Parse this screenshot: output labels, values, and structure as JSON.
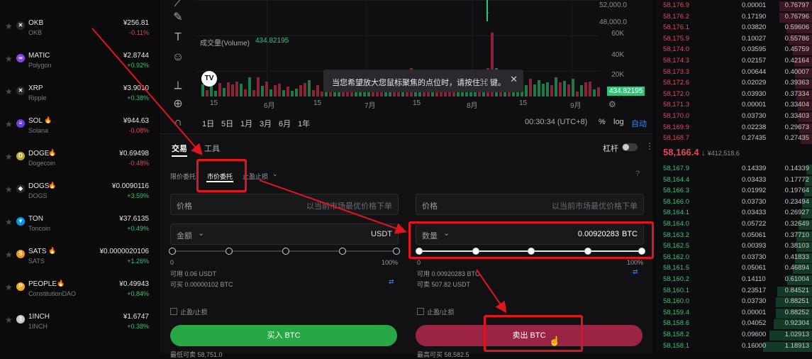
{
  "coins": [
    {
      "sym": "OKB",
      "name": "OKB",
      "price": "¥256.81",
      "chg": "-0.11%",
      "dir": "neg",
      "color": "#2b2b2b",
      "glyph": "✕",
      "fire": false
    },
    {
      "sym": "MATIC",
      "name": "Polygon",
      "price": "¥2.8744",
      "chg": "+0.92%",
      "dir": "pos",
      "color": "#8247e5",
      "glyph": "∞",
      "fire": false
    },
    {
      "sym": "XRP",
      "name": "Ripple",
      "price": "¥3.9010",
      "chg": "+0.38%",
      "dir": "pos",
      "color": "#2b2b2b",
      "glyph": "✕",
      "fire": false
    },
    {
      "sym": "SOL",
      "name": "Solana",
      "price": "¥944.63",
      "chg": "-0.08%",
      "dir": "neg",
      "color": "#6a3de0",
      "glyph": "≡",
      "fire": true
    },
    {
      "sym": "DOGE",
      "name": "Dogecoin",
      "price": "¥0.69498",
      "chg": "-0.48%",
      "dir": "neg",
      "color": "#c2a633",
      "glyph": "D",
      "fire": true
    },
    {
      "sym": "DOGS",
      "name": "DOGS",
      "price": "¥0.0090116",
      "chg": "+3.59%",
      "dir": "pos",
      "color": "#2b2b2b",
      "glyph": "◆",
      "fire": true
    },
    {
      "sym": "TON",
      "name": "Toncoin",
      "price": "¥37.6135",
      "chg": "+0.49%",
      "dir": "pos",
      "color": "#0098ea",
      "glyph": "▼",
      "fire": false
    },
    {
      "sym": "SATS",
      "name": "SATS",
      "price": "¥0.0000020106",
      "chg": "+1.26%",
      "dir": "pos",
      "color": "#f7931a",
      "glyph": "S",
      "fire": true
    },
    {
      "sym": "PEOPLE",
      "name": "ConstitutionDAO",
      "price": "¥0.49943",
      "chg": "+0.84%",
      "dir": "pos",
      "color": "#f5a623",
      "glyph": "P",
      "fire": true
    },
    {
      "sym": "1INCH",
      "name": "1INCH",
      "price": "¥1.6747",
      "chg": "+0.38%",
      "dir": "pos",
      "color": "#c9c9cc",
      "glyph": "1",
      "fire": false
    }
  ],
  "chart": {
    "volume_label": "成交量(Volume)",
    "volume_value": "434.82195",
    "yaxis": [
      "52,000.0",
      "48,000.0",
      "60K",
      "40K",
      "20K"
    ],
    "last_volume": "434.82195",
    "xlabels": [
      "15",
      "6月",
      "15",
      "7月",
      "15",
      "8月",
      "15",
      "9月"
    ],
    "timeframes": [
      "1日",
      "5日",
      "1月",
      "3月",
      "6月",
      "1年"
    ],
    "time": "00:30:34 (UTC+8)",
    "pct": "%",
    "log": "log",
    "auto": "自动",
    "tooltip": "当您希望放大您鼠标聚焦的点位时，请按住⌘ 键。"
  },
  "trade": {
    "tabs": [
      "交易",
      "工具"
    ],
    "leverage": "杠杆",
    "order_types": [
      "限价委托",
      "市价委托",
      "止盈止损"
    ],
    "buy": {
      "price_label": "价格",
      "price_ph": "以当前市场最优价格下单",
      "amount_label": "金额",
      "amount_unit": "USDT",
      "pct0": "0",
      "pct100": "100%",
      "avail": "可用 0.06 USDT",
      "can": "可买 0.00000102 BTC",
      "tp": "止盈/止损",
      "btn": "买入 BTC",
      "bottom": "最低可卖 58,751.0"
    },
    "sell": {
      "price_label": "价格",
      "price_ph": "以当前市场最优价格下单",
      "qty_label": "数量",
      "qty_value": "0.00920283",
      "qty_unit": "BTC",
      "pct0": "0",
      "pct100": "100%",
      "avail": "可用 0.00920283 BTC",
      "can": "可卖 507.82 USDT",
      "tp": "止盈/止损",
      "btn": "卖出 BTC",
      "bottom": "最高可买 58,582.5"
    }
  },
  "orderbook": {
    "asks": [
      [
        "58,176.9",
        "0.00001",
        "0.76797"
      ],
      [
        "58,176.2",
        "0.17190",
        "0.76796"
      ],
      [
        "58,176.1",
        "0.03820",
        "0.59606"
      ],
      [
        "58,175.9",
        "0.10027",
        "0.55786"
      ],
      [
        "58,174.0",
        "0.03595",
        "0.45759"
      ],
      [
        "58,174.3",
        "0.02157",
        "0.42164"
      ],
      [
        "58,173.3",
        "0.00644",
        "0.40007"
      ],
      [
        "58,172.6",
        "0.02029",
        "0.39363"
      ],
      [
        "58,172.0",
        "0.03930",
        "0.37334"
      ],
      [
        "58,171.3",
        "0.00001",
        "0.33404"
      ],
      [
        "58,170.0",
        "0.03730",
        "0.33403"
      ],
      [
        "58,169.9",
        "0.02238",
        "0.29673"
      ],
      [
        "58,168.7",
        "0.27435",
        "0.27435"
      ]
    ],
    "last_price": "58,166.4",
    "last_arrow": "↓",
    "last_cny": "¥412,518.6",
    "bids": [
      [
        "58,167.9",
        "0.14339",
        "0.14339"
      ],
      [
        "58,164.4",
        "0.03433",
        "0.17772"
      ],
      [
        "58,166.3",
        "0.01992",
        "0.19764"
      ],
      [
        "58,166.0",
        "0.03730",
        "0.23494"
      ],
      [
        "58,164.1",
        "0.03433",
        "0.26927"
      ],
      [
        "58,164.0",
        "0.05722",
        "0.32649"
      ],
      [
        "58,163.2",
        "0.05061",
        "0.37710"
      ],
      [
        "58,162.5",
        "0.00393",
        "0.38103"
      ],
      [
        "58,162.0",
        "0.03730",
        "0.41833"
      ],
      [
        "58,161.5",
        "0.05061",
        "0.46894"
      ],
      [
        "58,160.2",
        "0.14110",
        "0.61004"
      ],
      [
        "58,160.1",
        "0.23517",
        "0.84521"
      ],
      [
        "58,160.0",
        "0.03730",
        "0.88251"
      ],
      [
        "58,159.4",
        "0.00001",
        "0.88252"
      ],
      [
        "58,158.6",
        "0.04052",
        "0.92304"
      ],
      [
        "58,158.2",
        "0.09600",
        "1.02913"
      ],
      [
        "58,158.1",
        "0.16000",
        "1.18913"
      ]
    ]
  }
}
